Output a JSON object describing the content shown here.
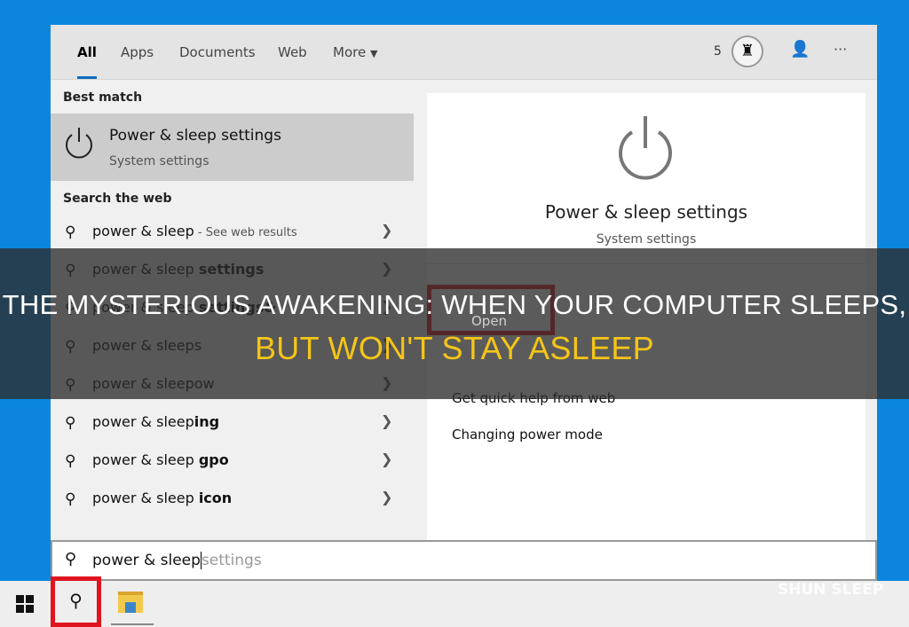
{
  "tabs": [
    {
      "label": "All"
    },
    {
      "label": "Apps"
    },
    {
      "label": "Documents"
    },
    {
      "label": "Web"
    },
    {
      "label": "More"
    }
  ],
  "header": {
    "points": "5",
    "icons": [
      "trophy-icon",
      "feedback-icon",
      "more-icon"
    ]
  },
  "best_match": {
    "heading": "Best match",
    "title": "Power & sleep settings",
    "subtitle": "System settings"
  },
  "web": {
    "heading": "Search the web",
    "items": [
      {
        "base": "power & sleep",
        "bold": "",
        "hint": " - See web results"
      },
      {
        "base": "power & sleep ",
        "bold": "settings",
        "hint": ""
      },
      {
        "base": "power & sleep ",
        "bold": "settings&",
        "hint": ""
      },
      {
        "base": "power & sleeps",
        "bold": "",
        "hint": ""
      },
      {
        "base": "power & sleepow",
        "bold": "",
        "hint": ""
      },
      {
        "base": "power & sleep",
        "bold": "ing",
        "hint": ""
      },
      {
        "base": "power & sleep ",
        "bold": "gpo",
        "hint": ""
      },
      {
        "base": "power & sleep ",
        "bold": "icon",
        "hint": ""
      }
    ]
  },
  "preview": {
    "title": "Power & sleep settings",
    "subtitle": "System settings",
    "actions": [
      {
        "label": "Open"
      },
      {
        "label": "Get quick help from web"
      },
      {
        "label": "Changing power mode"
      }
    ]
  },
  "search": {
    "typed": "power & sleep",
    "suggestion": "settings"
  },
  "banner": {
    "line1": "THE MYSTERIOUS AWAKENING: WHEN YOUR COMPUTER SLEEPS,",
    "line2": "BUT WON'T STAY ASLEEP"
  },
  "watermark": "SHUN SLEEP",
  "colors": {
    "accent": "#0b86dc",
    "highlight": "#e0141e",
    "banner_yellow": "#f5c518"
  }
}
